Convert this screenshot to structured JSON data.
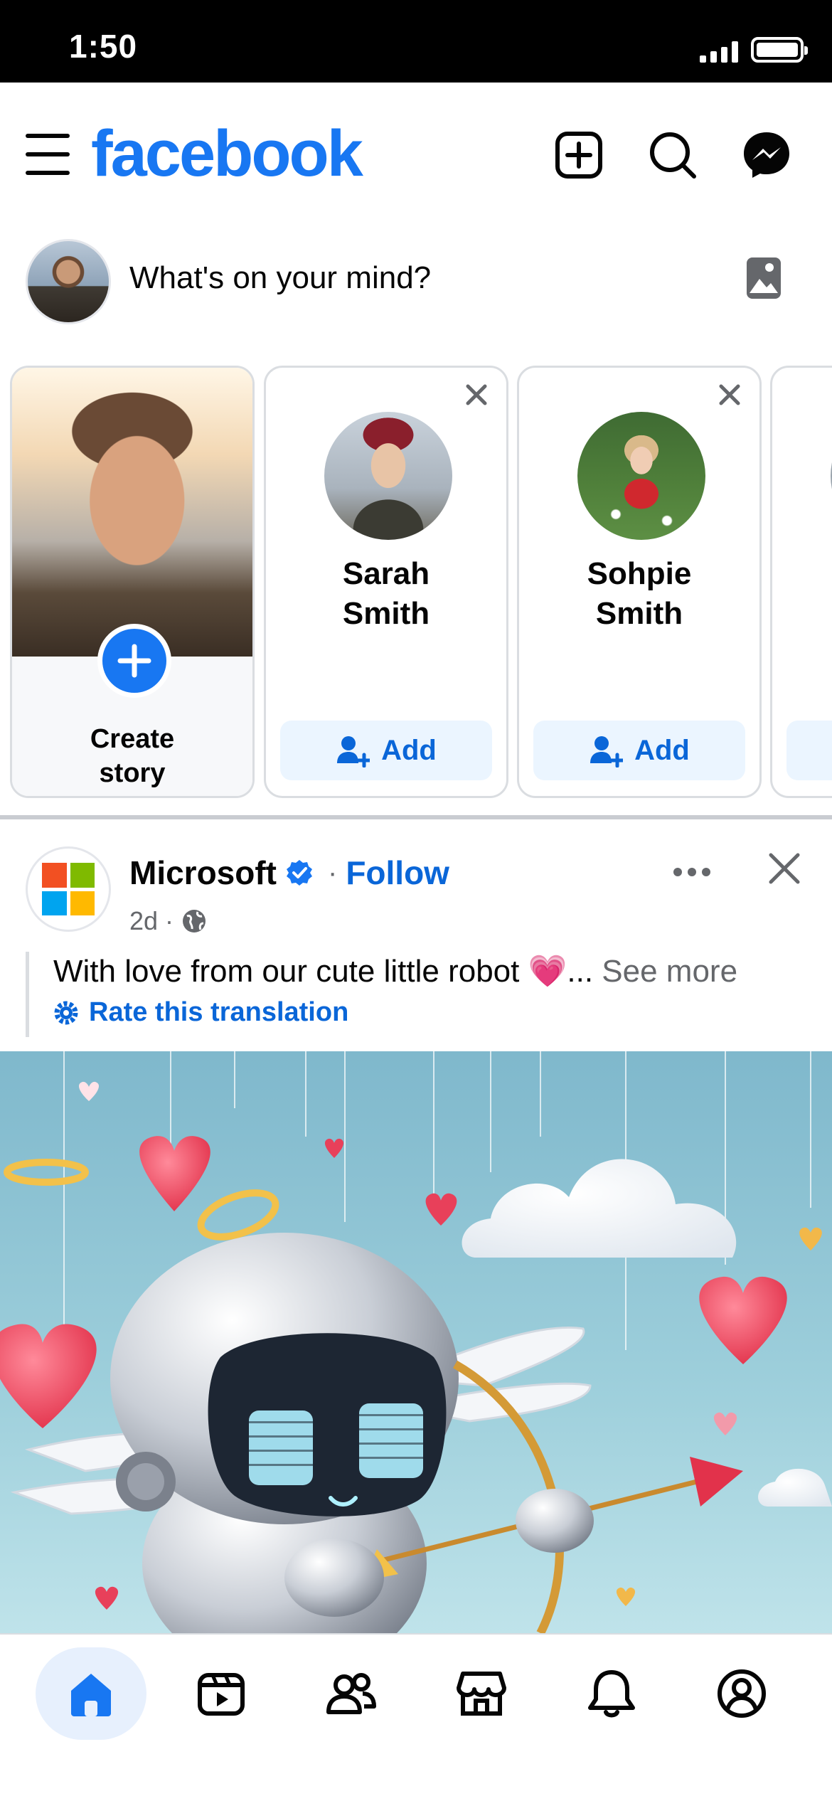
{
  "status_bar": {
    "time": "1:50"
  },
  "header": {
    "brand": "facebook",
    "icons": [
      "menu-icon",
      "create-icon",
      "search-icon",
      "messenger-icon"
    ]
  },
  "composer": {
    "placeholder": "What's on your mind?"
  },
  "stories": {
    "create_label": "Create story",
    "suggestions": [
      {
        "name": "Sarah Smith",
        "action": "Add"
      },
      {
        "name": "Sohpie Smith",
        "action": "Add"
      }
    ]
  },
  "post": {
    "author": "Microsoft",
    "follow_label": "Follow",
    "separator": "·",
    "time": "2d",
    "text": "With love from our cute little robot 💗...",
    "see_more": "See more",
    "rate_translation": "Rate this translation"
  },
  "bottom_nav": {
    "items": [
      "home-icon",
      "video-icon",
      "friends-icon",
      "marketplace-icon",
      "notifications-icon",
      "profile-icon"
    ],
    "active": "home-icon"
  },
  "colors": {
    "brand": "#1877f2",
    "link": "#0a66d8",
    "muted": "#65676b"
  }
}
